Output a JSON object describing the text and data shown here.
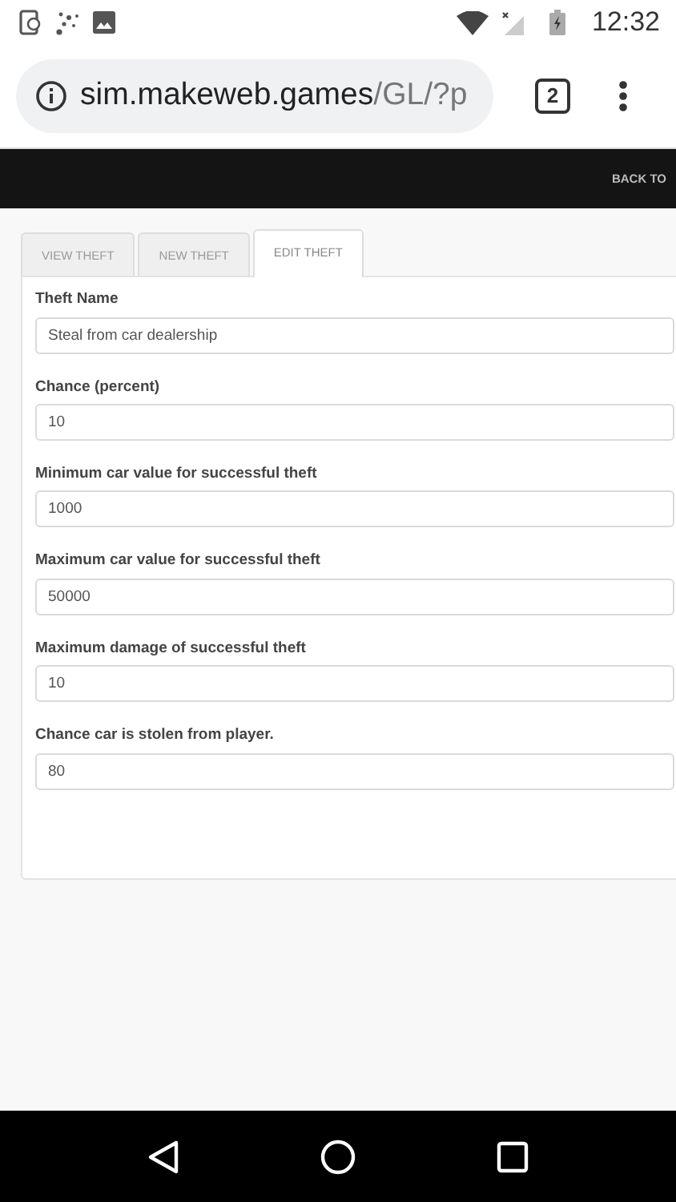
{
  "status_bar": {
    "time": "12:32"
  },
  "browser": {
    "url_host": "sim.makeweb.games",
    "url_path": "/GL/?p",
    "tab_count": "2"
  },
  "header": {
    "link": "BACK TO"
  },
  "tabs": [
    {
      "label": "VIEW THEFT",
      "selected": false
    },
    {
      "label": "NEW THEFT",
      "selected": false
    },
    {
      "label": "EDIT THEFT",
      "selected": true
    }
  ],
  "fields": [
    {
      "label": "Theft Name",
      "value": "Steal from car dealership"
    },
    {
      "label": "Chance (percent)",
      "value": "10"
    },
    {
      "label": "Minimum car value for successful theft",
      "value": "1000"
    },
    {
      "label": "Maximum car value for successful theft",
      "value": "50000"
    },
    {
      "label": "Maximum damage of successful theft",
      "value": "10"
    },
    {
      "label": "Chance car is stolen from player.",
      "value": "80"
    }
  ]
}
